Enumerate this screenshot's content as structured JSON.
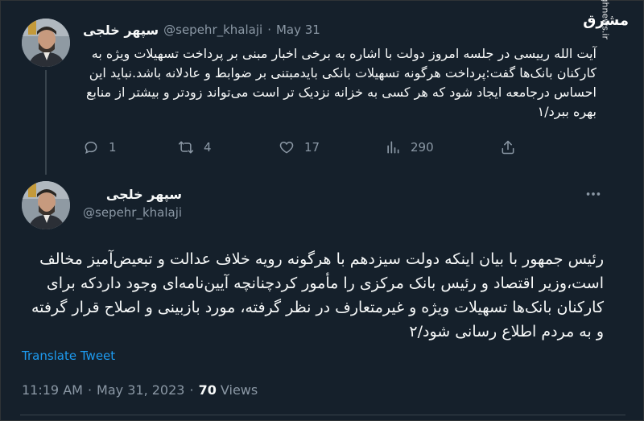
{
  "watermark": {
    "logo": "مشرق",
    "url": "mashreghnews.ir"
  },
  "tweet1": {
    "name": "سپهر خلجی",
    "handle": "@sepehr_khalaji",
    "dot": "·",
    "date": "May 31",
    "text": "آیت الله رییسی در جلسه امروز دولت با اشاره به برخی اخبار مبنی بر پرداخت تسهیلات ویژه به کارکنان بانک‌ها گفت:پرداخت هرگونه تسهیلات بانکی بایدمبتنی بر ضوابط و عادلانه باشد.نباید این احساس درجامعه ایجاد شود که هر کسی به خزانه نزدیک تر است می‌تواند زودتر و بیشتر از منابع بهره ببرد/۱",
    "replies": "1",
    "retweets": "4",
    "likes": "17",
    "views": "290"
  },
  "tweet2": {
    "name": "سپهر خلجی",
    "handle": "@sepehr_khalaji",
    "text": "رئیس جمهور با بیان اینکه دولت سیزدهم با هرگونه رویه خلاف عدالت و تبعیض‌آمیز مخالف است،وزیر اقتصاد و رئیس بانک مرکزی را مأمور کردچنانچه آیین‌نامه‌ای وجود داردکه برای کارکنان بانک‌ها تسهیلات ویژه و غیرمتعارف در نظر گرفته، مورد بازبینی و اصلاح قرار گرفته و به مردم اطلاع رسانی شود/۲",
    "translate_label": "Translate Tweet",
    "time": "11:19 AM",
    "dot1": "·",
    "date": "May 31, 2023",
    "dot2": "·",
    "views_count": "70",
    "views_label": "Views"
  },
  "icons": {
    "reply": "reply-icon",
    "retweet": "retweet-icon",
    "like": "heart-icon",
    "views": "views-icon",
    "share": "share-icon",
    "more": "more-icon"
  }
}
